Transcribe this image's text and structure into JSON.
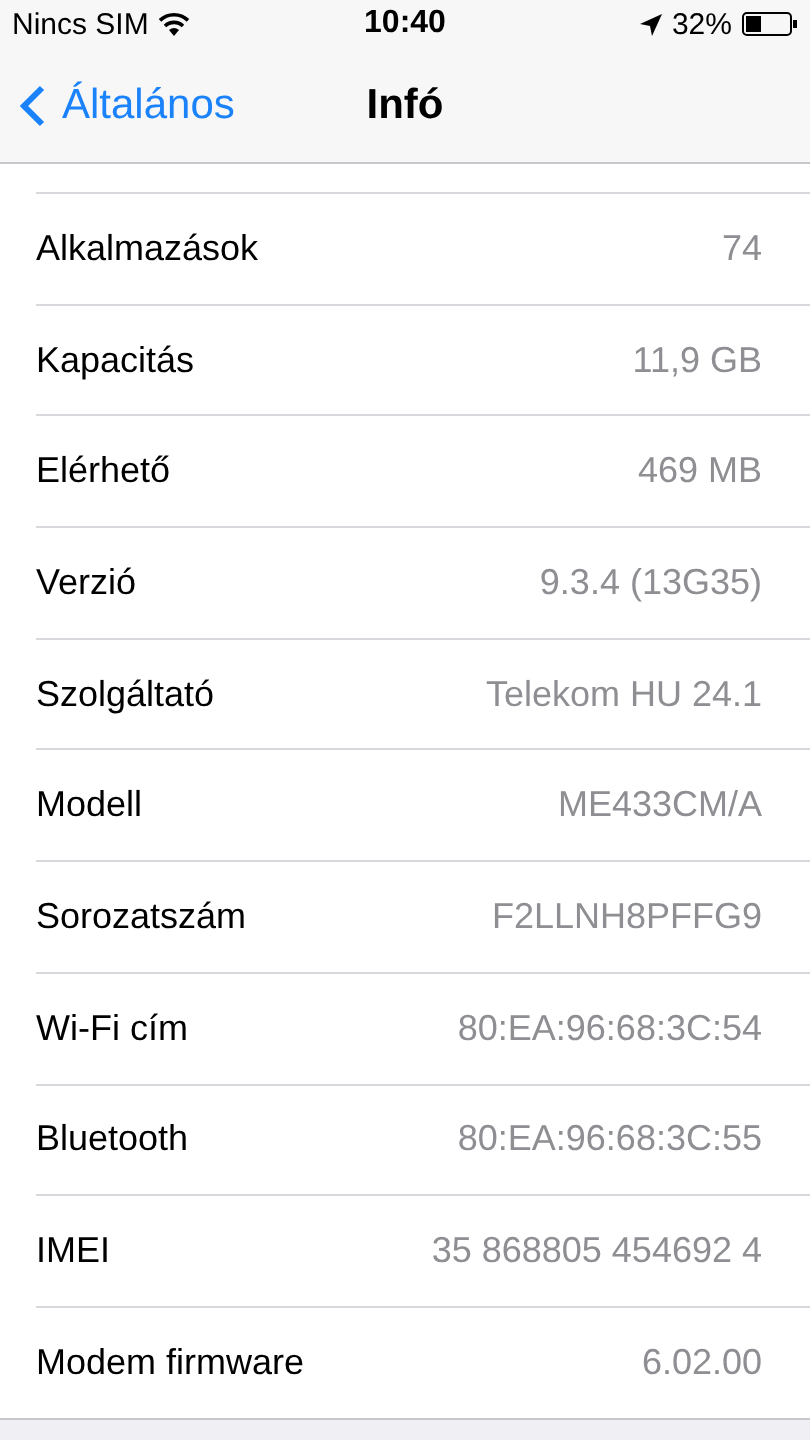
{
  "status_bar": {
    "carrier": "Nincs SIM",
    "time": "10:40",
    "battery": "32%"
  },
  "nav_bar": {
    "back": "Általános",
    "title": "Infó"
  },
  "rows": [
    {
      "label": "Alkalmazások",
      "value": "74"
    },
    {
      "label": "Kapacitás",
      "value": "11,9 GB"
    },
    {
      "label": "Elérhető",
      "value": "469 MB"
    },
    {
      "label": "Verzió",
      "value": "9.3.4 (13G35)"
    },
    {
      "label": "Szolgáltató",
      "value": "Telekom HU 24.1"
    },
    {
      "label": "Modell",
      "value": "ME433CM/A"
    },
    {
      "label": "Sorozatszám",
      "value": "F2LLNH8PFFG9"
    },
    {
      "label": "Wi-Fi cím",
      "value": "80:EA:96:68:3C:54"
    },
    {
      "label": "Bluetooth",
      "value": "80:EA:96:68:3C:55"
    },
    {
      "label": "IMEI",
      "value": "35 868805 454692 4"
    },
    {
      "label": "Modem firmware",
      "value": "6.02.00"
    }
  ]
}
